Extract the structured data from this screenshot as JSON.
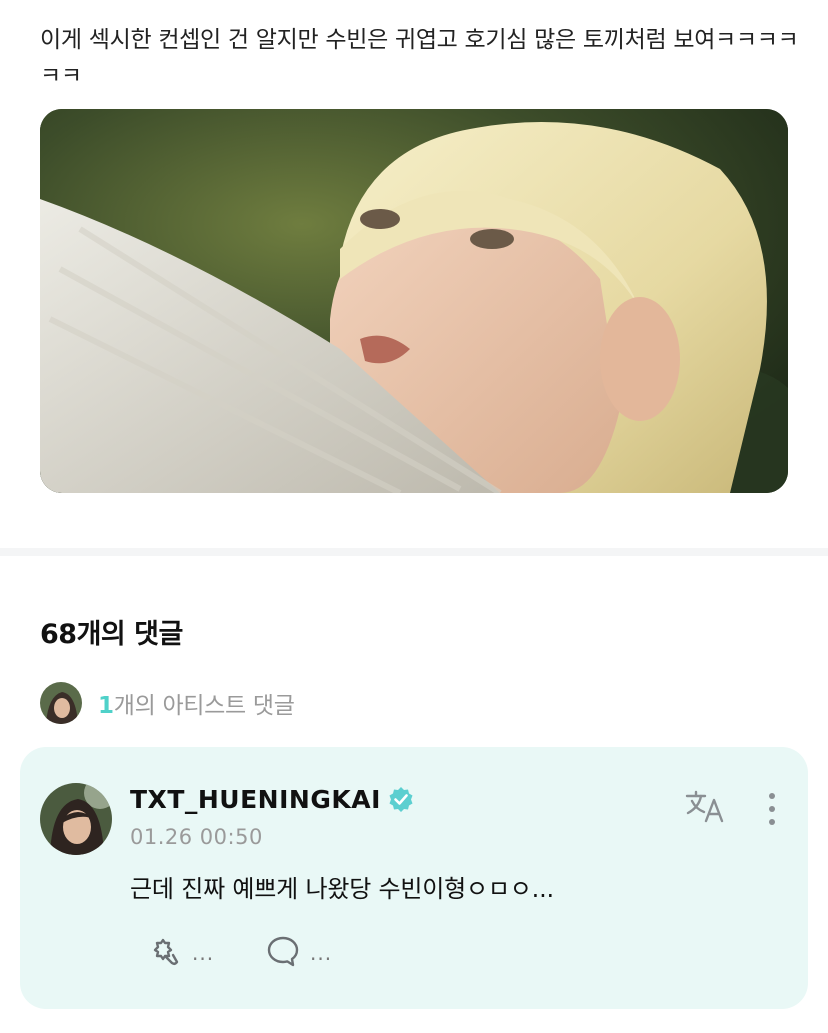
{
  "post": {
    "text": "이게 섹시한 컨셉인 건 알지만 수빈은 귀엽고 호기심 많은 토끼처럼 보여ㅋㅋㅋㅋㅋㅋ"
  },
  "comments": {
    "heading": "68개의 댓글",
    "artist_count_num": "1",
    "artist_count_label": "개의 아티스트 댓글"
  },
  "comment": {
    "username": "TXT_HUENINGKAI",
    "timestamp": "01.26 00:50",
    "body": "근데 진짜 예쁘게 나왔당 수빈이형ㅇㅁㅇ...",
    "like_count": "...",
    "reply_count": "..."
  },
  "colors": {
    "accent": "#4fd1c9",
    "card_background": "#e9f8f6",
    "verified_badge": "#5ccfd0"
  },
  "icons": [
    "verified-badge-icon",
    "translate-icon",
    "more-vertical-icon",
    "like-icon",
    "reply-icon"
  ]
}
